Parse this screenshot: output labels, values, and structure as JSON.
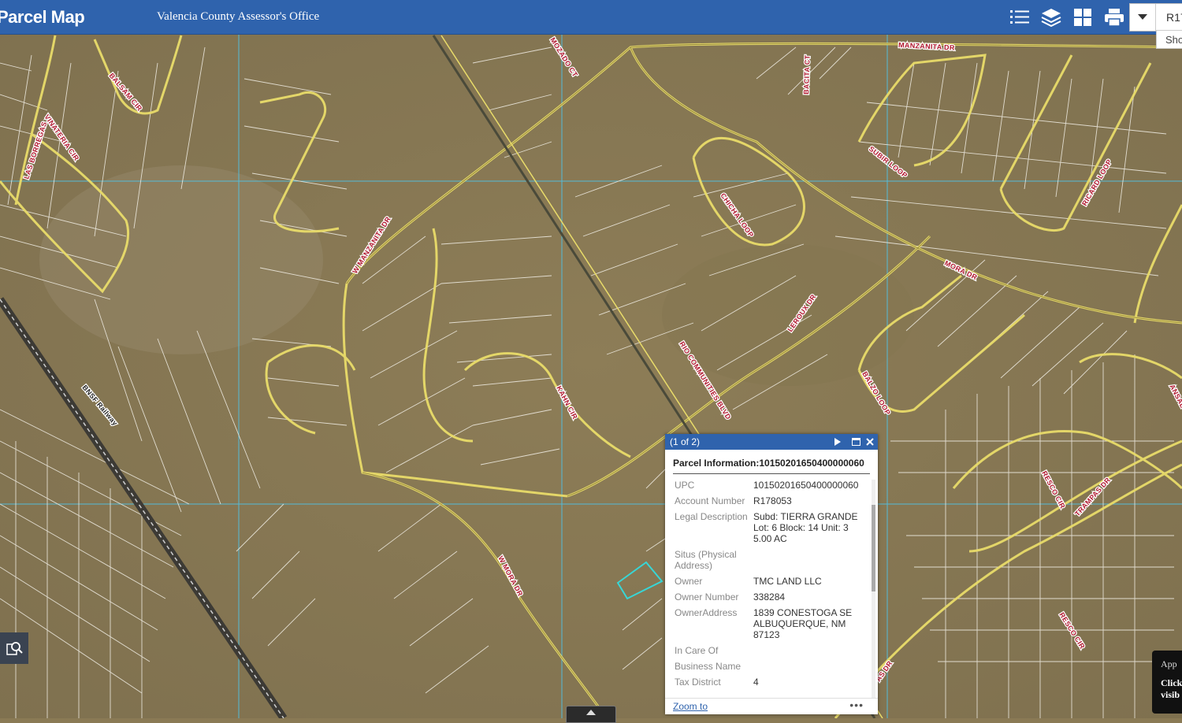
{
  "header": {
    "title": "Parcel Map",
    "subtitle": "Valencia County Assessor's Office",
    "tools": [
      "legend-icon",
      "layers-icon",
      "basemap-gallery-icon",
      "print-icon"
    ],
    "search_value": "R17",
    "show_label": "Sho"
  },
  "map": {
    "road_labels": [
      "MANZANITA DR",
      "MOZADO CT",
      "BACITA CT",
      "BALSAM CIR",
      "VINATERIA CIR",
      "LAS BORREGAS",
      "SUBIR LOOP",
      "RICARD LOOP",
      "CHICHA LOOP",
      "W MANZANITA DR",
      "MORA DR",
      "LEROUX DR",
      "RIO COMMUNITIES BLVD",
      "BALZO LOOP",
      "BNSF Railway",
      "KAHN CIR",
      "W MORA DR",
      "RESCO CIR",
      "TRAMPAS DR",
      "RESCO CIR",
      "AS DR",
      "ANSAL"
    ]
  },
  "popup": {
    "pager": "(1 of 2)",
    "title": "Parcel Information:10150201650400000060",
    "fields": [
      {
        "label": "UPC",
        "value": "10150201650400000060"
      },
      {
        "label": "Account Number",
        "value": "R178053"
      },
      {
        "label": "Legal Description",
        "value": "Subd: TIERRA GRANDE Lot: 6 Block: 14 Unit: 3 5.00 AC"
      },
      {
        "label": "Situs (Physical Address)",
        "value": ""
      },
      {
        "label": "Owner",
        "value": "TMC LAND LLC"
      },
      {
        "label": "Owner Number",
        "value": "338284"
      },
      {
        "label": "OwnerAddress",
        "value": "1839 CONESTOGA SE ALBUQUERQUE, NM 87123"
      },
      {
        "label": "In Care Of",
        "value": ""
      },
      {
        "label": "Business Name",
        "value": ""
      },
      {
        "label": "Tax District",
        "value": "4"
      }
    ],
    "zoom_label": "Zoom to",
    "more_label": "•••"
  },
  "app_panel": {
    "line1": "App",
    "line2": "Click",
    "line3": "visib"
  }
}
